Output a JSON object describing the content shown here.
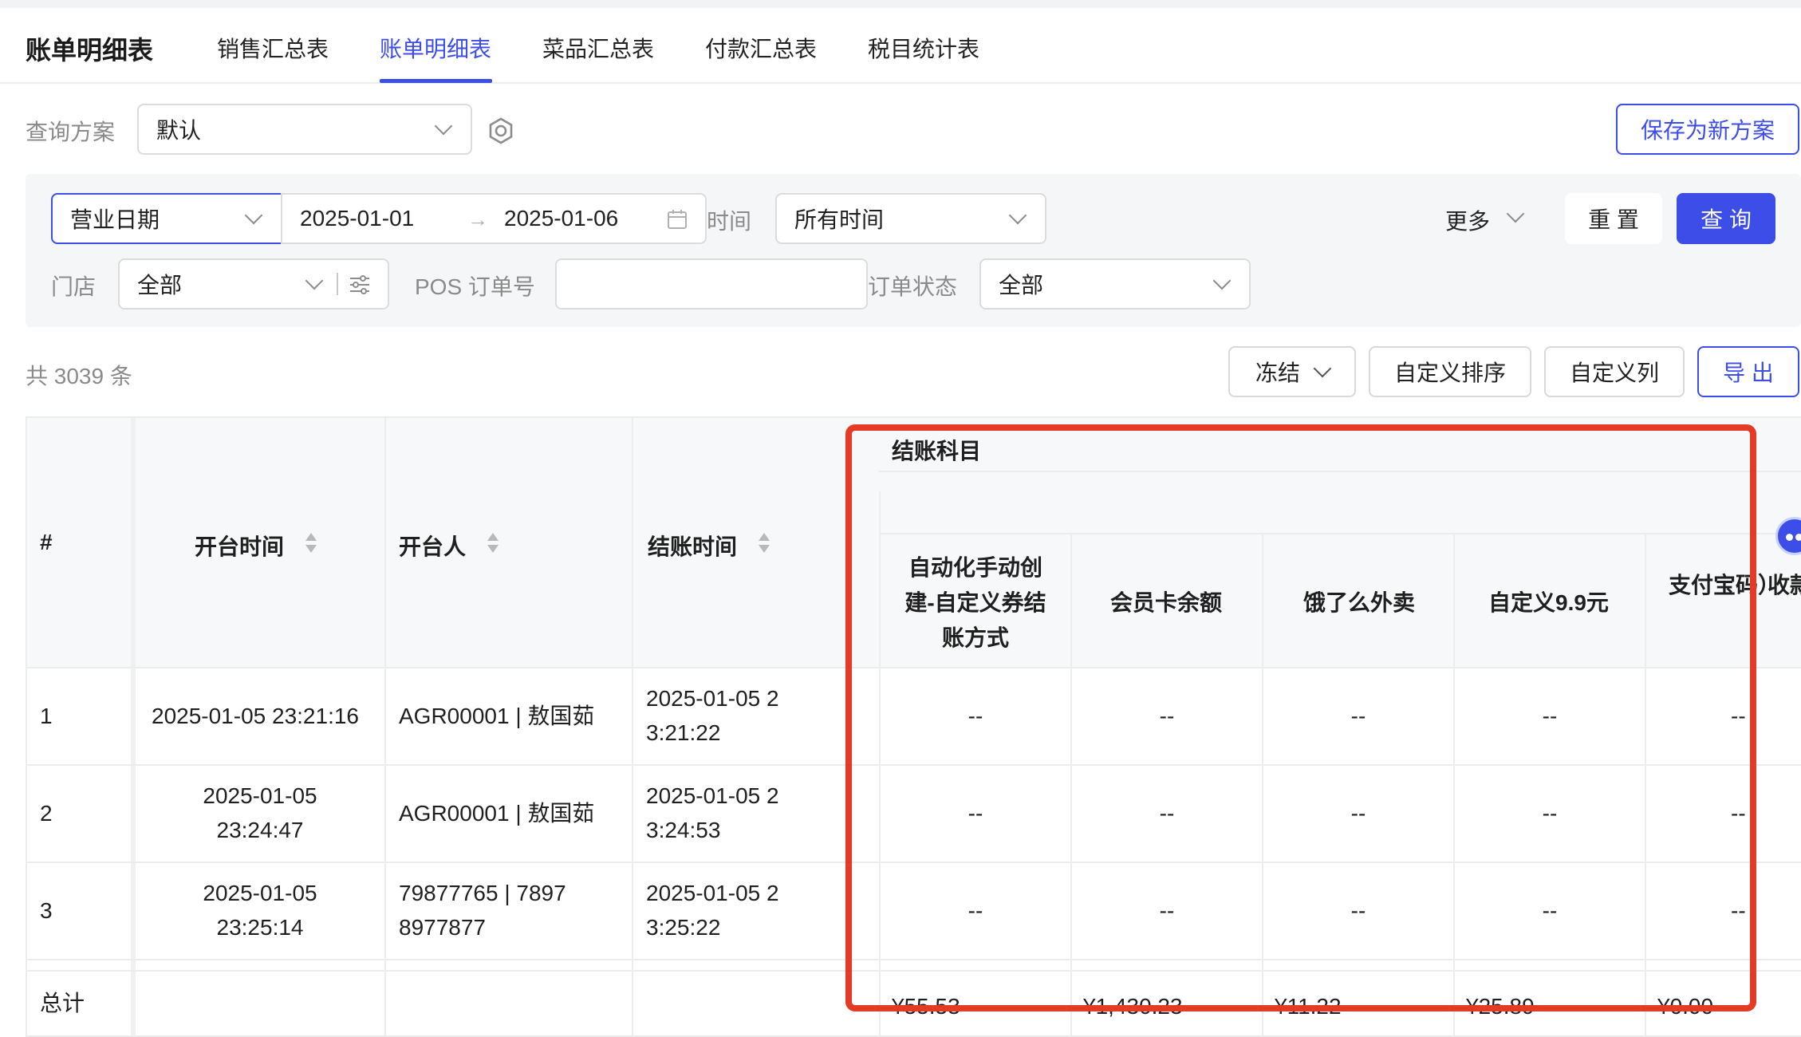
{
  "page_title": "账单明细表",
  "tabs": [
    {
      "label": "销售汇总表",
      "active": false
    },
    {
      "label": "账单明细表",
      "active": true
    },
    {
      "label": "菜品汇总表",
      "active": false
    },
    {
      "label": "付款汇总表",
      "active": false
    },
    {
      "label": "税目统计表",
      "active": false
    }
  ],
  "scheme": {
    "label": "查询方案",
    "value": "默认",
    "save_button": "保存为新方案"
  },
  "filters": {
    "date_type": "营业日期",
    "date_start": "2025-01-01",
    "date_end": "2025-01-06",
    "time_label": "时间",
    "time_value": "所有时间",
    "more_label": "更多",
    "reset_label": "重 置",
    "query_label": "查 询",
    "store_label": "门店",
    "store_value": "全部",
    "pos_label": "POS 订单号",
    "pos_value": "",
    "status_label": "订单状态",
    "status_value": "全部"
  },
  "toolbar": {
    "count_text": "共 3039 条",
    "freeze_label": "冻结",
    "custom_sort_label": "自定义排序",
    "custom_cols_label": "自定义列",
    "export_label": "导 出"
  },
  "table": {
    "headers": {
      "index": "#",
      "open_time": "开台时间",
      "opener": "开台人",
      "checkout_time": "结账时间",
      "group": "结账科目",
      "sub": [
        "自动化手动创建-自定义券结账方式",
        "会员卡余额",
        "饿了么外卖",
        "自定义9.9元",
        "支付宝码）",
        "收款"
      ]
    },
    "rows": [
      {
        "index": "1",
        "open_time": "2025-01-05 23:21:16",
        "opener": "AGR00001 | 敖国茹",
        "checkout_time": "2025-01-05 23:21:22",
        "values": [
          "--",
          "--",
          "--",
          "--",
          "--"
        ]
      },
      {
        "index": "2",
        "open_time": "2025-01-05 23:24:47",
        "opener": "AGR00001 | 敖国茹",
        "checkout_time": "2025-01-05 23:24:53",
        "values": [
          "--",
          "--",
          "--",
          "--",
          "--"
        ]
      },
      {
        "index": "3",
        "open_time": "2025-01-05 23:25:14",
        "opener": "79877765 | 78978977877",
        "checkout_time": "2025-01-05 23:25:22",
        "values": [
          "--",
          "--",
          "--",
          "--",
          "--"
        ]
      }
    ],
    "total": {
      "label": "总计",
      "values": [
        "¥55.53",
        "¥1,430.23",
        "¥11.22",
        "¥25.89",
        "¥0.00"
      ]
    }
  },
  "colors": {
    "primary": "#3d4ee8",
    "highlight_border": "#e43b27"
  }
}
